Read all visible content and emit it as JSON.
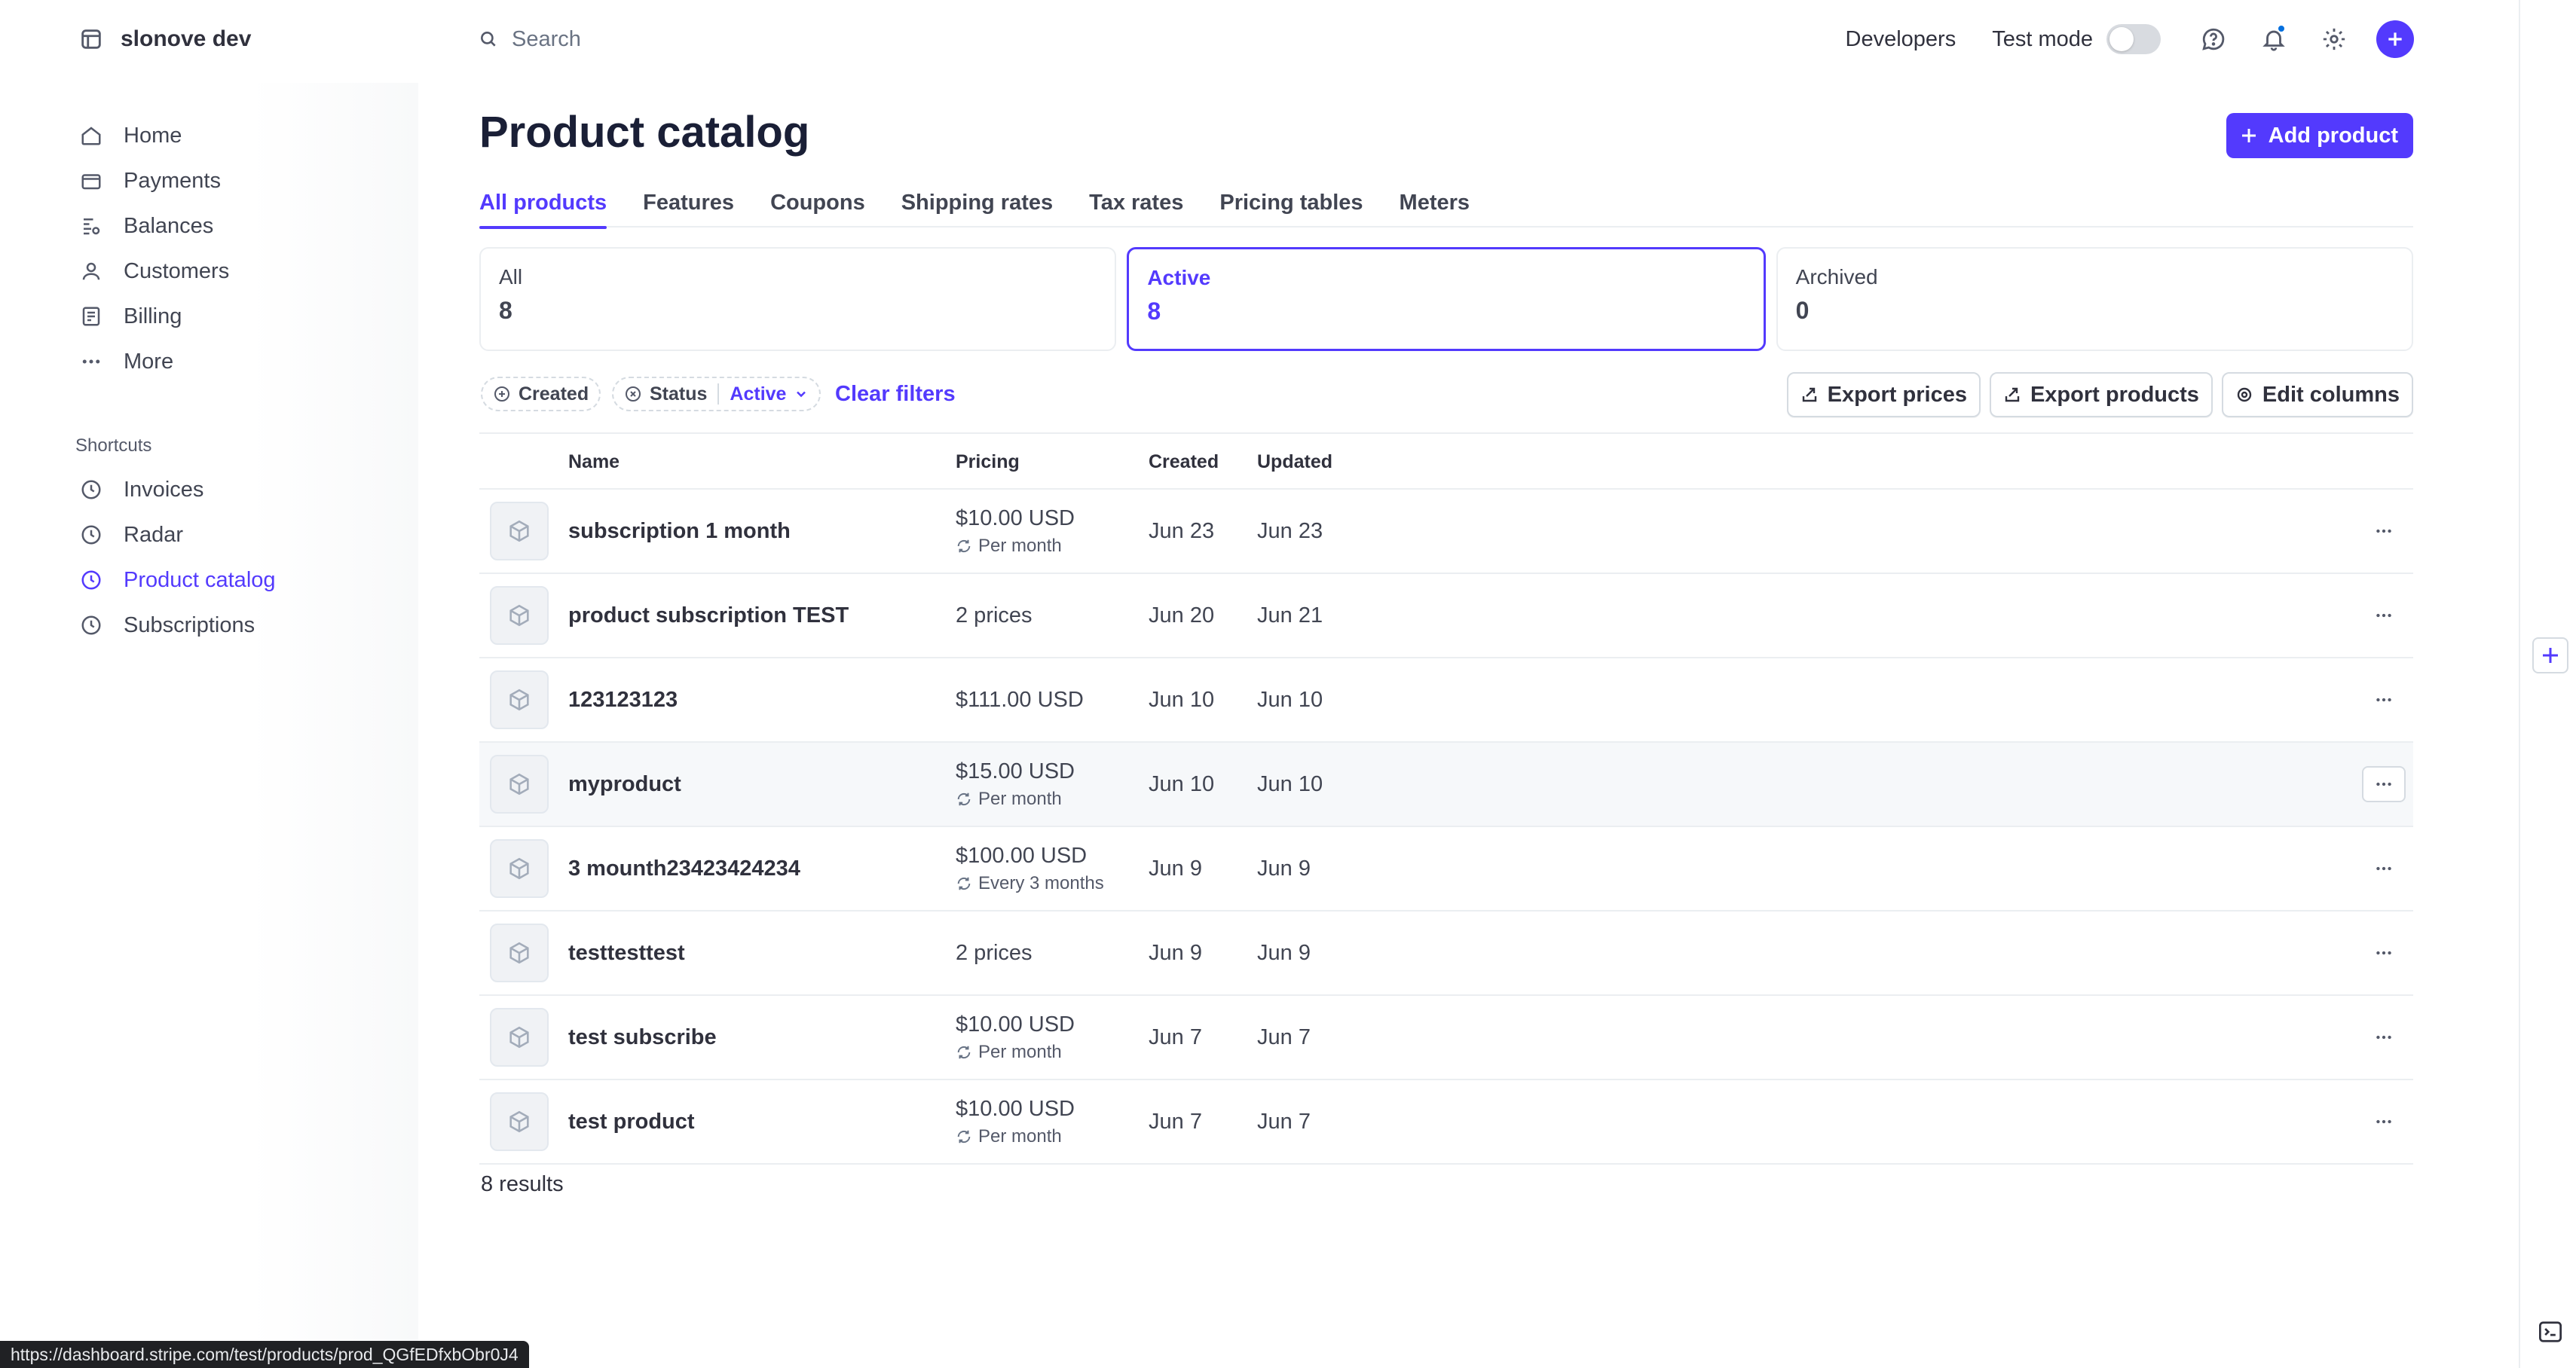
{
  "account": {
    "name": "slonove dev"
  },
  "sidebar": {
    "items": [
      {
        "label": "Home",
        "icon": "home-icon"
      },
      {
        "label": "Payments",
        "icon": "payments-icon"
      },
      {
        "label": "Balances",
        "icon": "balances-icon"
      },
      {
        "label": "Customers",
        "icon": "customers-icon"
      },
      {
        "label": "Billing",
        "icon": "billing-icon"
      },
      {
        "label": "More",
        "icon": "more-icon"
      }
    ],
    "shortcuts_label": "Shortcuts",
    "shortcuts": [
      {
        "label": "Invoices"
      },
      {
        "label": "Radar"
      },
      {
        "label": "Product catalog",
        "active": true
      },
      {
        "label": "Subscriptions"
      }
    ]
  },
  "topbar": {
    "search_placeholder": "Search",
    "developers": "Developers",
    "test_mode": "Test mode"
  },
  "page": {
    "title": "Product catalog",
    "add_button": "Add product",
    "tabs": [
      "All products",
      "Features",
      "Coupons",
      "Shipping rates",
      "Tax rates",
      "Pricing tables",
      "Meters"
    ],
    "cards": [
      {
        "label": "All",
        "count": "8"
      },
      {
        "label": "Active",
        "count": "8"
      },
      {
        "label": "Archived",
        "count": "0"
      }
    ],
    "filters": {
      "created": "Created",
      "status": "Status",
      "status_value": "Active",
      "clear": "Clear filters",
      "export_prices": "Export prices",
      "export_products": "Export products",
      "edit_columns": "Edit columns"
    },
    "table": {
      "headers": {
        "name": "Name",
        "pricing": "Pricing",
        "created": "Created",
        "updated": "Updated"
      },
      "rows": [
        {
          "name": "subscription 1 month",
          "price": "$10.00 USD",
          "interval": "Per month",
          "created": "Jun 23",
          "updated": "Jun 23"
        },
        {
          "name": "product subscription TEST",
          "price": "2 prices",
          "interval": "",
          "created": "Jun 20",
          "updated": "Jun 21"
        },
        {
          "name": "123123123",
          "price": "$111.00 USD",
          "interval": "",
          "created": "Jun 10",
          "updated": "Jun 10"
        },
        {
          "name": "myproduct",
          "price": "$15.00 USD",
          "interval": "Per month",
          "created": "Jun 10",
          "updated": "Jun 10"
        },
        {
          "name": "3 mounth23423424234",
          "price": "$100.00 USD",
          "interval": "Every 3 months",
          "created": "Jun 9",
          "updated": "Jun 9"
        },
        {
          "name": "testtesttest",
          "price": "2 prices",
          "interval": "",
          "created": "Jun 9",
          "updated": "Jun 9"
        },
        {
          "name": "test subscribe",
          "price": "$10.00 USD",
          "interval": "Per month",
          "created": "Jun 7",
          "updated": "Jun 7"
        },
        {
          "name": "test product",
          "price": "$10.00 USD",
          "interval": "Per month",
          "created": "Jun 7",
          "updated": "Jun 7"
        }
      ]
    },
    "results": "8 results"
  },
  "statusbar": {
    "url": "https://dashboard.stripe.com/test/products/prod_QGfEDfxbObr0J4"
  },
  "colors": {
    "accent": "#533afd",
    "text": "#1a1f36",
    "border": "#ebeef1"
  }
}
